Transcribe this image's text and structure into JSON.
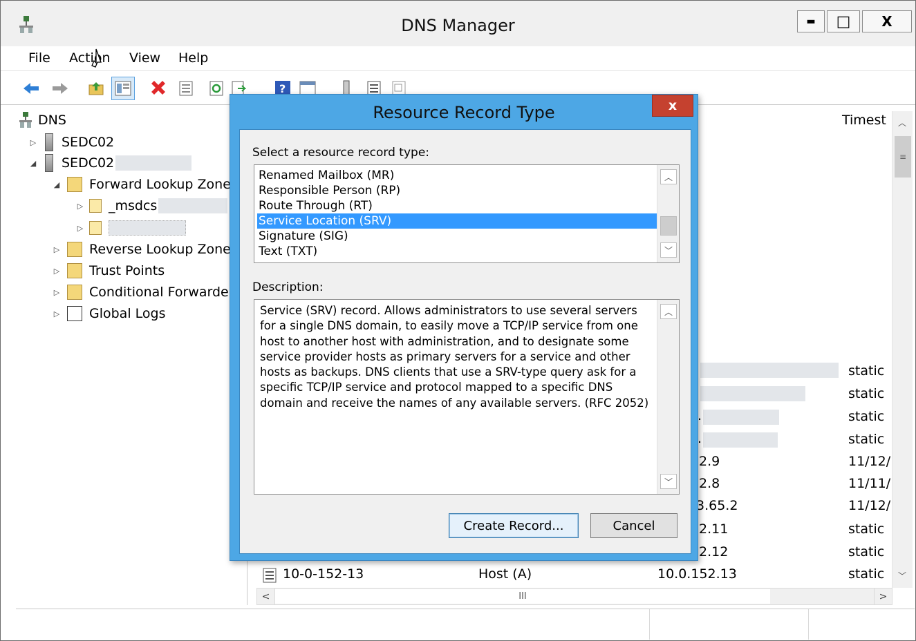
{
  "window": {
    "title": "DNS Manager",
    "minimize_glyph": "▬",
    "maximize_glyph": "□",
    "close_glyph": "X"
  },
  "menu": [
    "File",
    "Action",
    "View",
    "Help"
  ],
  "toolbar_icons": [
    "back-arrow-icon",
    "forward-arrow-icon",
    "up-folder-icon",
    "show-hide-tree-icon",
    "delete-icon",
    "properties-icon",
    "refresh-icon",
    "export-list-icon",
    "help-icon",
    "action-pane-icon",
    "server-icon",
    "list-icon",
    "filter-icon"
  ],
  "tree": {
    "root": "DNS",
    "items": [
      {
        "label": "SEDC02",
        "level": 1
      },
      {
        "label": "SEDC02",
        "level": 1
      },
      {
        "label": "Forward Lookup Zone",
        "level": 2
      },
      {
        "label": "_msdcs",
        "level": 3
      },
      {
        "label": "",
        "level": 3
      },
      {
        "label": "Reverse Lookup Zones",
        "level": 2
      },
      {
        "label": "Trust Points",
        "level": 2
      },
      {
        "label": "Conditional Forwarde",
        "level": 2
      },
      {
        "label": "Global Logs",
        "level": 2
      }
    ]
  },
  "list": {
    "column_timestamp": "Timest",
    "rows": [
      {
        "data": "",
        "timestamp": "static"
      },
      {
        "data": "",
        "timestamp": "static"
      },
      {
        "data": ".",
        "timestamp": "static"
      },
      {
        "data": ".",
        "timestamp": "static"
      },
      {
        "data": "2.9",
        "timestamp": "11/12/"
      },
      {
        "data": "2.8",
        "timestamp": "11/11/"
      },
      {
        "data": "3.65.2",
        "timestamp": "11/12/"
      },
      {
        "data": "2.11",
        "timestamp": "static"
      },
      {
        "data": "2.12",
        "timestamp": "static"
      },
      {
        "name": "10-0-152-13",
        "type": "Host (A)",
        "data": "10.0.152.13",
        "timestamp": "static"
      }
    ],
    "hscroll_thumb": "III"
  },
  "dialog": {
    "title": "Resource Record Type",
    "close_glyph": "x",
    "select_label": "Select a resource record type:",
    "record_types": [
      "Renamed Mailbox (MR)",
      "Responsible Person (RP)",
      "Route Through (RT)",
      "Service Location (SRV)",
      "Signature (SIG)",
      "Text (TXT)"
    ],
    "selected_index": 3,
    "description_label": "Description:",
    "description_lines": [
      "Service (SRV) record. Allows administrators to use several servers",
      "for a single DNS domain, to easily move a TCP/IP service from one",
      "host to another host with administration, and to designate some",
      "service provider hosts as primary servers for a service and other",
      "hosts as backups. DNS clients that use a SRV-type query ask for a",
      "specific TCP/IP service and protocol mapped to a specific DNS",
      "domain and receive the names of any available servers. (RFC 2052)"
    ],
    "create_button": "Create Record...",
    "cancel_button": "Cancel"
  }
}
